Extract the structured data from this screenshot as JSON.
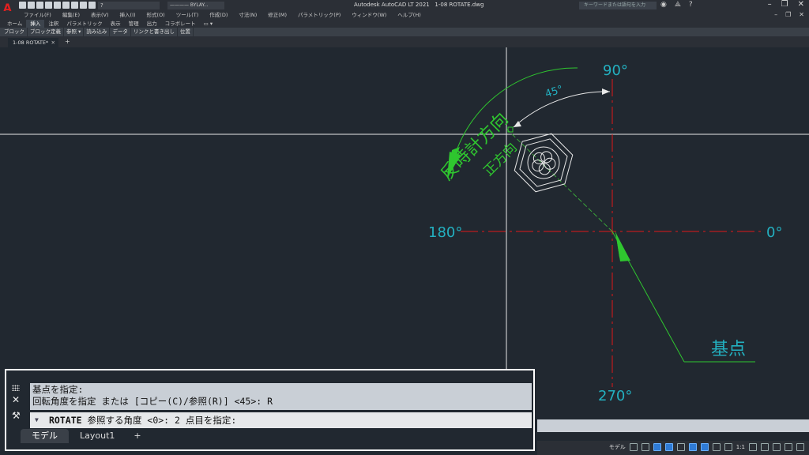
{
  "titlebar": {
    "app_title": "Autodesk AutoCAD LT 2021",
    "file_name": "1-08 ROTATE.dwg",
    "layer_value": "?",
    "linetype_value": "———— BYLAY...",
    "search_placeholder": "キーワードまたは語句を入力"
  },
  "menu": [
    "ファイル(F)",
    "編集(E)",
    "表示(V)",
    "挿入(I)",
    "形式(O)",
    "ツール(T)",
    "作成(D)",
    "寸法(N)",
    "修正(M)",
    "パラメトリック(P)",
    "ウィンドウ(W)",
    "ヘルプ(H)"
  ],
  "ribbon_tabs": [
    "ホーム",
    "挿入",
    "注釈",
    "パラメトリック",
    "表示",
    "管理",
    "出力",
    "コラボレート",
    "▭ ▾"
  ],
  "ribbon_panels": [
    "ブロック",
    "ブロック定義",
    "参照 ▾",
    "読み込み",
    "データ",
    "リンクと書き出し",
    "位置"
  ],
  "doc_tab": {
    "label": "1-08 ROTATE*",
    "close": "✕",
    "add": "+"
  },
  "drawing": {
    "angle_90": "90°",
    "angle_0": "0°",
    "angle_180": "180°",
    "angle_270": "270°",
    "angle_45": "45°",
    "ccw_label": "反時計方向",
    "positive_label": "正方向",
    "base_point_label": "基点",
    "colors": {
      "axis": "#e01818",
      "annotation": "#2fc62f",
      "text": "#23b0c0",
      "crosshair": "#e8e8e8"
    }
  },
  "command": {
    "history_line1": "基点を指定:",
    "history_line2": "回転角度を指定 または [コピー(C)/参照(R)] <45>: R",
    "input_command": "ROTATE",
    "input_prompt": " 参照する角度 <0>:  2 点目を指定:",
    "close_icon": "✕",
    "wrench_icon": "🔧"
  },
  "layout_tabs": {
    "model": "モデル",
    "layout1": "Layout1",
    "add": "+"
  },
  "statusbar": {
    "model": "モデル",
    "scale": "1:1"
  }
}
